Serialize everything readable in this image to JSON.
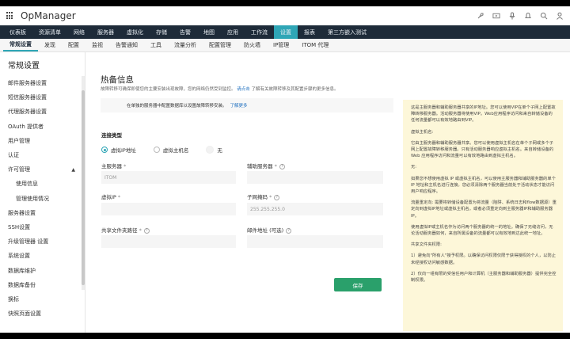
{
  "app": {
    "title": "OpManager"
  },
  "top_icons": [
    "rocket-icon",
    "video-icon",
    "microphone-icon",
    "bell-icon",
    "search-icon",
    "user-icon"
  ],
  "colors": {
    "nav_bg": "#1e2b39",
    "nav_active": "#2fa6b6",
    "save_button": "#2aa06b",
    "help_bg": "#fdf7d9"
  },
  "main_nav": [
    "仪表板",
    "资源清单",
    "网络",
    "服务器",
    "虚拟化",
    "存储",
    "告警",
    "地图",
    "应用",
    "工作流",
    "设置",
    "报表",
    "第三方嵌入测试"
  ],
  "main_nav_active": "设置",
  "sub_nav": [
    "常规设置",
    "发现",
    "配置",
    "监视",
    "告警通知",
    "工具",
    "流量分析",
    "配置管理",
    "防火墙",
    "IP管理",
    "ITOM 代理"
  ],
  "sub_nav_active": "常规设置",
  "sidebar": {
    "title": "常规设置",
    "items": [
      {
        "label": "邮件服务器设置",
        "sub": false
      },
      {
        "label": "短信服务器设置",
        "sub": false
      },
      {
        "label": "代理服务器设置",
        "sub": false
      },
      {
        "label": "OAuth 提供者",
        "sub": false
      },
      {
        "label": "用户管理",
        "sub": false
      },
      {
        "label": "认证",
        "sub": false
      },
      {
        "label": "许可管理",
        "sub": false,
        "expandable": true
      },
      {
        "label": "使用信息",
        "sub": true
      },
      {
        "label": "管理使用情况",
        "sub": true
      },
      {
        "label": "服务器设置",
        "sub": false
      },
      {
        "label": "SSH设置",
        "sub": false
      },
      {
        "label": "升级管理器 设置",
        "sub": false
      },
      {
        "label": "系统设置",
        "sub": false
      },
      {
        "label": "数据库维护",
        "sub": false
      },
      {
        "label": "数据库备份",
        "sub": false
      },
      {
        "label": "换标",
        "sub": false
      },
      {
        "label": "快照页面设置",
        "sub": false
      }
    ]
  },
  "main": {
    "title": "热备信息",
    "description": "故障转移可确保即使您的主要安装出现故障，您的网络仍然受到监控。",
    "description_link": "请点击",
    "description_tail": "了解有关故障转移及其配置步骤的更多信息。",
    "notice": "在单独的服务器中配置数据库以设置故障转移安装。",
    "notice_link": "了解更多",
    "connection_type_label": "连接类型",
    "radio_options": [
      {
        "label": "虚拟IP地址",
        "checked": true
      },
      {
        "label": "虚拟主机名",
        "checked": false
      },
      {
        "label": "无",
        "checked": false
      }
    ],
    "primary_server_label": "主服务器",
    "primary_server_value": "ITOM",
    "secondary_server_label": "辅助服务器",
    "secondary_server_value": "",
    "virtual_ip_label": "虚拟IP",
    "virtual_ip_value": "",
    "subnet_mask_label": "子网掩码",
    "subnet_mask_placeholder": "255.255.255.0",
    "shared_folder_label": "共享文件夹路径",
    "shared_folder_value": "",
    "email_label": "邮件地址 (可选)",
    "email_value": "",
    "save_label": "保存"
  },
  "help_panel": {
    "paragraphs": [
      "这是主服务器和辅助服务器共享的IP地址。您可以使用VIP在单个子网上配置故障转移服务器。活动服务器将使用VIP。Web应用程序访问和来自转储设备的任何流量都可以有效地路由到VIP。",
      "虚拟主机名:",
      "它由主服务器和辅助服务器共享。您可以使用虚拟主机名在单个子网或多个子网上配置故障转移服务器。只有活动服务器响应虚拟主机名。来自转储设备的 Web 应用程序访问和流量可以有效地路由到虚拟主机名。",
      "无:",
      "如果您不想使用虚拟 IP 或虚拟主机名，可以使用主服务器和辅助服务器的单个 IP 地址和主机名进行连接。您必须清除两个服务器当前处于活动状态才能访问用户响应程序。",
      "流量重定向: 需要将转储设备配置为将流量（陷阱、系统日志和flow数据源）重定向到虚拟IP地址或虚拟主机名。或者必须重定向到主服务器IP和辅助服务器IP。",
      "使用虚拟IP或主机名作为访问两个服务器的统一的地址。确保了无缝访问，无论活动服务器如何，来自所属设备的流量都可以有效地到达此统一地址。",
      "共享文件夹权限:",
      "1）避免向\"所有人\"授予权限。以确保访问权限仅限于获得授权的个人，以防止未经授权访问敏感数据。",
      "2）仅向一组有限的受信任用户和计算机（主服务器和辅助服务器）提供完全控制权限。"
    ]
  }
}
